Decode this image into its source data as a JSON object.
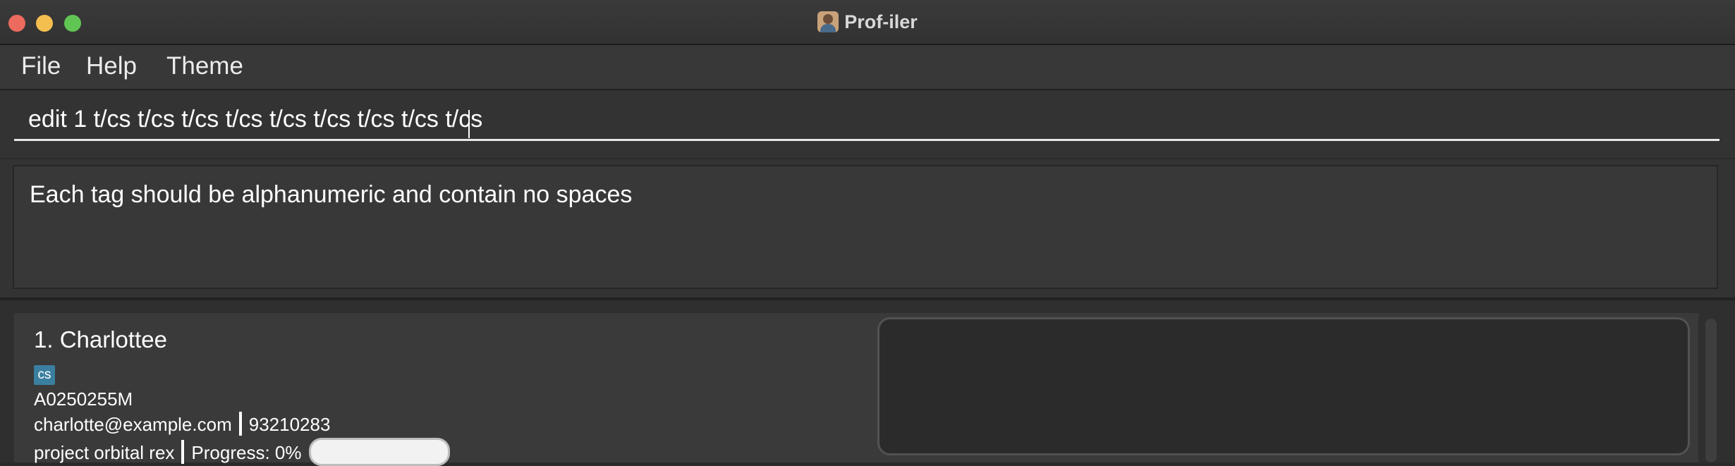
{
  "window": {
    "title": "Prof-iler"
  },
  "menu": {
    "file": "File",
    "help": "Help",
    "theme": "Theme"
  },
  "command": {
    "value": "edit 1 t/cs t/cs t/cs t/cs t/cs t/cs t/cs t/cs t/cs"
  },
  "result": {
    "message": "Each tag should be alphanumeric and contain no spaces"
  },
  "persons": [
    {
      "index_name": "1. Charlottee",
      "tag": "cs",
      "student_id": "A0250255M",
      "email": "charlotte@example.com",
      "phone": "93210283",
      "project": "project orbital rex",
      "progress_label": "Progress: 0%",
      "progress": 0
    }
  ],
  "colors": {
    "accent": "#3b7fa0",
    "background": "#2b2b2b"
  }
}
